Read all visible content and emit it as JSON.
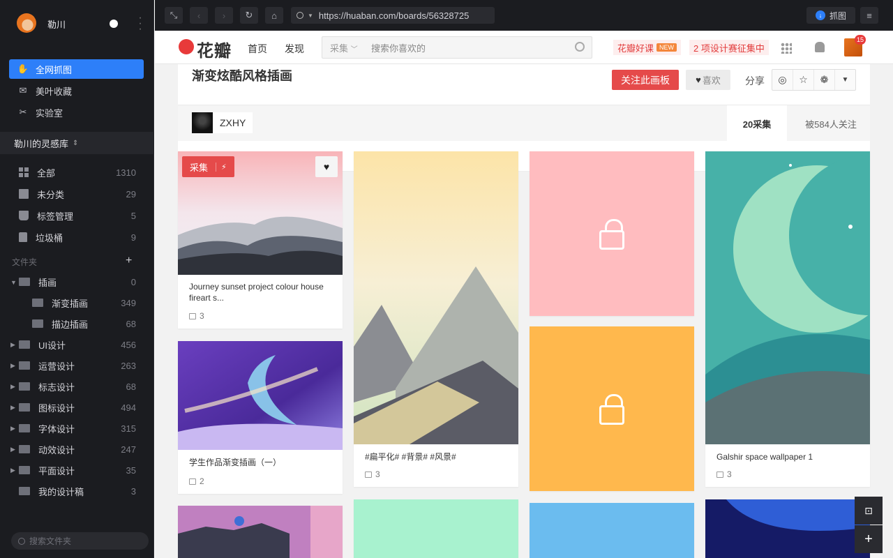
{
  "sidebar": {
    "user_name": "勒川",
    "nav": [
      {
        "label": "全网抓图",
        "icon": "hand-icon",
        "active": true
      },
      {
        "label": "美叶收藏",
        "icon": "inbox-icon",
        "active": false
      },
      {
        "label": "实验室",
        "icon": "lab-icon",
        "active": false
      }
    ],
    "library_label": "勒川的灵感库",
    "library_chevron": "⌃⌄",
    "items": [
      {
        "label": "全部",
        "count": "1310"
      },
      {
        "label": "未分类",
        "count": "29"
      },
      {
        "label": "标签管理",
        "count": "5"
      },
      {
        "label": "垃圾桶",
        "count": "9"
      }
    ],
    "folder_section_label": "文件夹",
    "folder_add": "+",
    "folders": [
      {
        "label": "插画",
        "count": "0",
        "expanded": true,
        "indent": 0
      },
      {
        "label": "渐变插画",
        "count": "349",
        "indent": 1
      },
      {
        "label": "描边插画",
        "count": "68",
        "indent": 1
      },
      {
        "label": "UI设计",
        "count": "456",
        "indent": 0
      },
      {
        "label": "运营设计",
        "count": "263",
        "indent": 0
      },
      {
        "label": "标志设计",
        "count": "68",
        "indent": 0
      },
      {
        "label": "图标设计",
        "count": "494",
        "indent": 0
      },
      {
        "label": "字体设计",
        "count": "315",
        "indent": 0
      },
      {
        "label": "动效设计",
        "count": "247",
        "indent": 0
      },
      {
        "label": "平面设计",
        "count": "35",
        "indent": 0
      },
      {
        "label": "我的设计稿",
        "count": "3",
        "indent": 0
      }
    ],
    "search_placeholder": "搜索文件夹"
  },
  "toolbar": {
    "url": "https://huaban.com/boards/56328725",
    "capture_label": "抓图"
  },
  "site": {
    "logo_text": "花瓣",
    "nav_home": "首页",
    "nav_discover": "发现",
    "search_category": "采集",
    "search_placeholder": "搜索你喜欢的",
    "promo1": "花瓣好课",
    "promo1_badge": "NEW",
    "promo2": "2 项设计赛征集中",
    "notif_count": "15"
  },
  "board": {
    "title": "渐变炫酷风格插画",
    "follow_label": "关注此画板",
    "like_label": "喜欢",
    "share_label": "分享",
    "owner": "ZXHY",
    "pins_stat": "20采集",
    "followers_stat": "被584人关注"
  },
  "pins": [
    {
      "desc": "Journey sunset project colour house fireart s...",
      "count": "3",
      "collect_label": "采集"
    },
    {
      "desc": "学生作品渐变插画（一）",
      "count": "2"
    },
    {
      "desc": "#扁平化# #背景# #风景#",
      "count": "3"
    },
    {
      "desc": "Galshir space wallpaper 1",
      "count": "3"
    }
  ],
  "colors": {
    "accent_blue": "#2d7ff9",
    "brand_red": "#e54a4a",
    "lock_pink": "#ffbcbf",
    "lock_orange": "#ffb84d",
    "mint": "#a8f2cf",
    "sky": "#6bbcef"
  }
}
